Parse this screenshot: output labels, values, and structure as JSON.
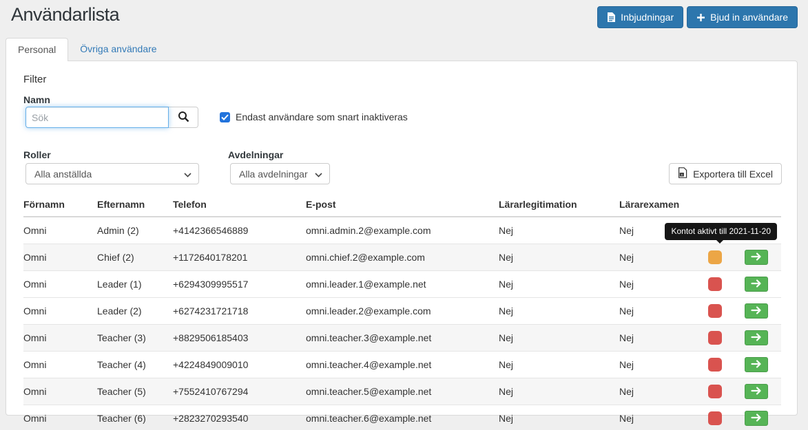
{
  "page": {
    "title": "Användarlista"
  },
  "header": {
    "buttons": [
      {
        "label": "Inbjudningar",
        "icon": "document-icon"
      },
      {
        "label": "Bjud in användare",
        "icon": "plus-icon"
      }
    ]
  },
  "tabs": [
    {
      "label": "Personal",
      "active": true
    },
    {
      "label": "Övriga användare",
      "active": false
    }
  ],
  "filter": {
    "title": "Filter",
    "name_label": "Namn",
    "search_placeholder": "Sök",
    "search_value": "",
    "checkbox_label": "Endast användare som snart inaktiveras",
    "checkbox_checked": true,
    "roles_label": "Roller",
    "roles_value": "Alla anställda",
    "departments_label": "Avdelningar",
    "departments_value": "Alla avdelningar",
    "export_label": "Exportera till Excel"
  },
  "table": {
    "columns": [
      "Förnamn",
      "Efternamn",
      "Telefon",
      "E-post",
      "Lärarlegitimation",
      "Lärarexamen"
    ],
    "rows": [
      {
        "first": "Omni",
        "last": "Admin (2)",
        "phone": "+4142366546889",
        "email": "omni.admin.2@example.com",
        "leg": "Nej",
        "exam": "Nej",
        "status": "orange"
      },
      {
        "first": "Omni",
        "last": "Chief (2)",
        "phone": "+1172640178201",
        "email": "omni.chief.2@example.com",
        "leg": "Nej",
        "exam": "Nej",
        "status": "orange"
      },
      {
        "first": "Omni",
        "last": "Leader (1)",
        "phone": "+6294309995517",
        "email": "omni.leader.1@example.net",
        "leg": "Nej",
        "exam": "Nej",
        "status": "red"
      },
      {
        "first": "Omni",
        "last": "Leader (2)",
        "phone": "+6274231721718",
        "email": "omni.leader.2@example.com",
        "leg": "Nej",
        "exam": "Nej",
        "status": "red"
      },
      {
        "first": "Omni",
        "last": "Teacher (3)",
        "phone": "+8829506185403",
        "email": "omni.teacher.3@example.net",
        "leg": "Nej",
        "exam": "Nej",
        "status": "red"
      },
      {
        "first": "Omni",
        "last": "Teacher (4)",
        "phone": "+4224849009010",
        "email": "omni.teacher.4@example.net",
        "leg": "Nej",
        "exam": "Nej",
        "status": "red"
      },
      {
        "first": "Omni",
        "last": "Teacher (5)",
        "phone": "+7552410767294",
        "email": "omni.teacher.5@example.net",
        "leg": "Nej",
        "exam": "Nej",
        "status": "red"
      },
      {
        "first": "Omni",
        "last": "Teacher (6)",
        "phone": "+2823270293540",
        "email": "omni.teacher.6@example.net",
        "leg": "Nej",
        "exam": "Nej",
        "status": "red"
      }
    ]
  },
  "tooltip": {
    "text": "Kontot aktivt till 2021-11-20"
  },
  "colors": {
    "button_blue": "#2d76ad",
    "checkbox_blue": "#2273dc",
    "link_blue": "#337ab7",
    "badge_orange": "#eca646",
    "badge_red": "#d9534f",
    "action_green": "#56b456",
    "tooltip_black": "#161616"
  }
}
